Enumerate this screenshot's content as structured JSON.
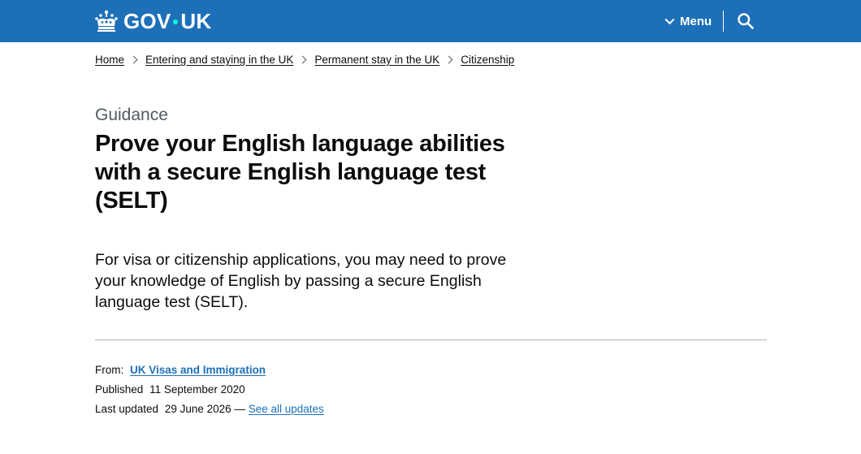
{
  "header": {
    "logo_text_left": "GOV",
    "logo_text_right": "UK",
    "menu_label": "Menu",
    "icons": [
      "crown-icon",
      "chevron-down-icon",
      "search-icon"
    ],
    "brand_color": "#1d70b8",
    "dot_color": "#00ffe0"
  },
  "breadcrumbs": [
    {
      "label": "Home"
    },
    {
      "label": "Entering and staying in the UK"
    },
    {
      "label": "Permanent stay in the UK"
    },
    {
      "label": "Citizenship"
    }
  ],
  "page": {
    "caption": "Guidance",
    "title": "Prove your English language abilities with a secure English language test (SELT)",
    "lede": "For visa or citizenship applications, you may need to prove your knowledge of English by passing a secure English language test (SELT)."
  },
  "metadata": {
    "from_label": "From:",
    "from_org": "UK Visas and Immigration",
    "published_label": "Published",
    "published_date": "11 September 2020",
    "updated_label": "Last updated",
    "updated_date": "29 June 2026",
    "updated_separator": "—",
    "see_all_updates": "See all updates",
    "link_color": "#1d70b8"
  }
}
